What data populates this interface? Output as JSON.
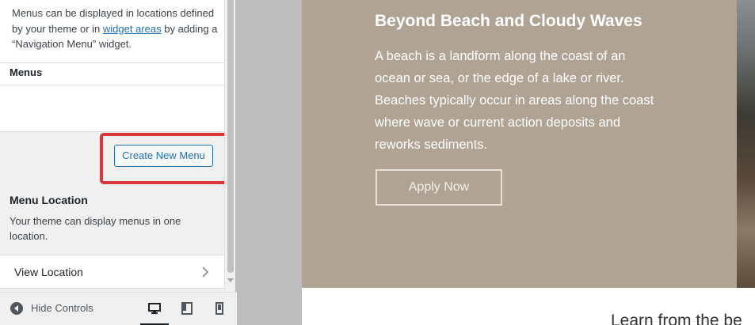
{
  "panel": {
    "intro": {
      "text_before": "Menus can be displayed in locations defined by your theme or in ",
      "link": "widget areas",
      "text_after": " by adding a “Navigation Menu” widget."
    },
    "menus_title": "Menus",
    "create_button": "Create New Menu",
    "menu_location": {
      "title": "Menu Location",
      "description": "Your theme can display menus in one location.",
      "view_location": "View Location"
    }
  },
  "footer": {
    "hide_controls": "Hide Controls",
    "devices": [
      "desktop",
      "tablet",
      "mobile"
    ],
    "active_device": "desktop"
  },
  "preview": {
    "hero_title": "Beyond Beach and Cloudy Waves",
    "hero_text": "A beach is a landform along the coast of an ocean or sea, or the edge of a lake or river. Beaches typically occur in areas along the coast where wave or current action deposits and reworks sediments.",
    "apply_button": "Apply Now",
    "next_heading": "Learn from the be"
  },
  "colors": {
    "accent": "#2271b1",
    "highlight": "#d9383a",
    "hero_bg": "#b0a393"
  }
}
